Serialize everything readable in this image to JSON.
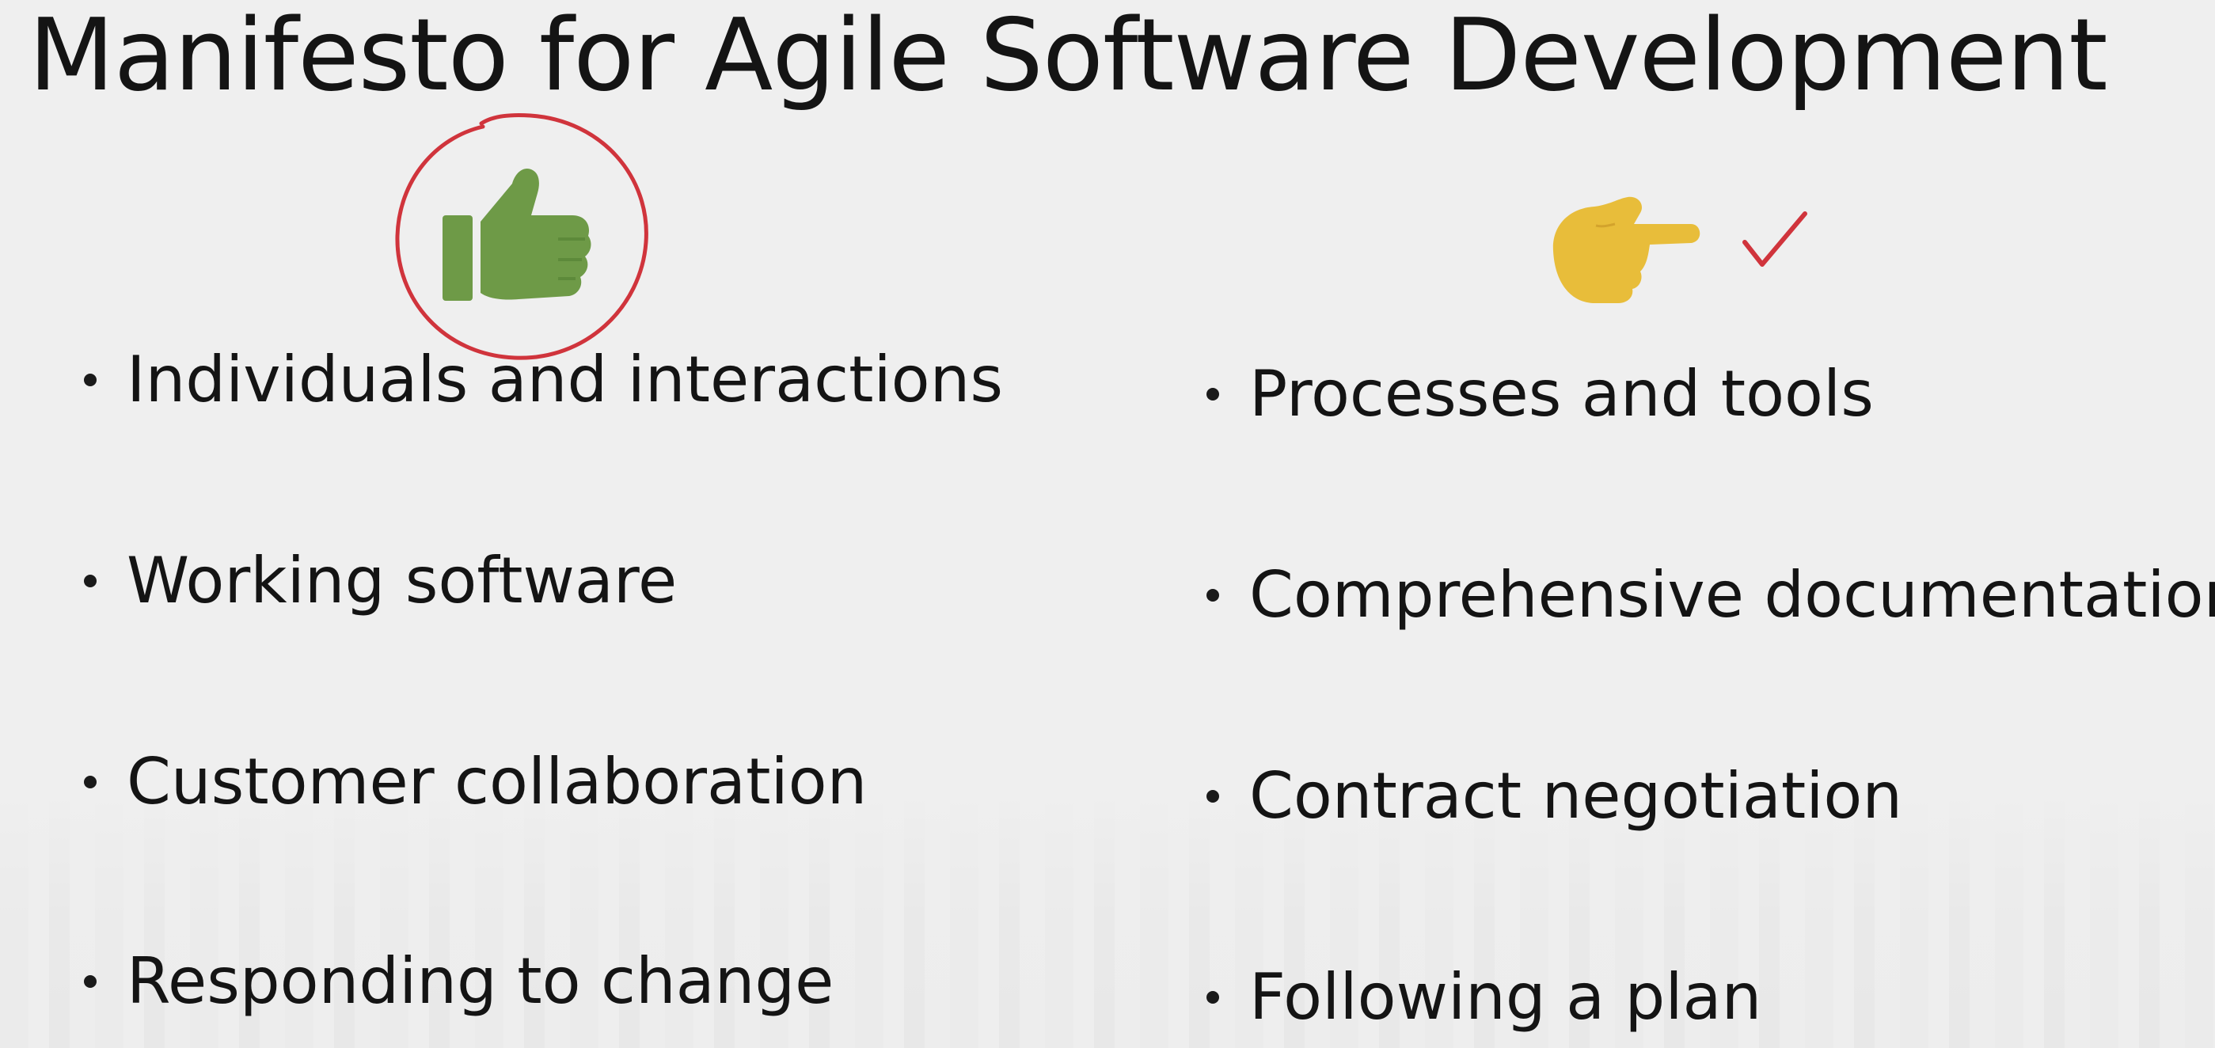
{
  "slide": {
    "title": "Manifesto for Agile Software Development",
    "left_column": {
      "icon": "thumbs-up-icon",
      "icon_color": "#6e9a47",
      "annotation": "red-circle",
      "items": [
        "Individuals and interactions",
        "Working software",
        "Customer collaboration",
        "Responding to change"
      ]
    },
    "right_column": {
      "icon": "pointing-hand-icon",
      "icon_color": "#e8bd3a",
      "annotation": "red-checkmark",
      "items": [
        "Processes and tools",
        "Comprehensive documentation",
        "Contract negotiation",
        "Following a plan"
      ]
    },
    "annotation_color": "#d0343c"
  }
}
